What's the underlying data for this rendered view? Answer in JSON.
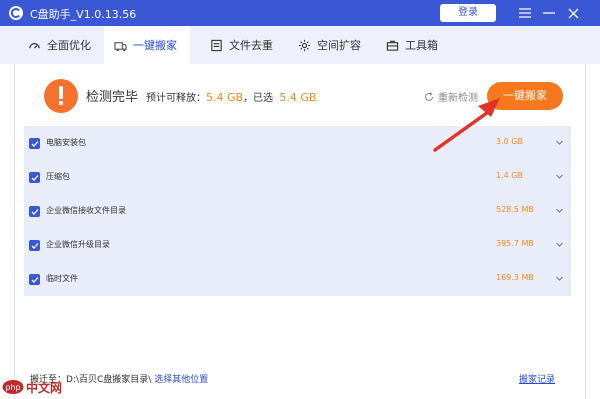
{
  "window": {
    "title": "C盘助手_V1.0.13.56",
    "login_label": "登录",
    "icons": [
      "app-logo-icon",
      "menu-icon",
      "minimize-icon",
      "close-icon"
    ]
  },
  "tabs": [
    {
      "label": "全面优化",
      "icon": "dashboard-icon",
      "active": false
    },
    {
      "label": "一键搬家",
      "icon": "move-icon",
      "active": true
    },
    {
      "label": "文件去重",
      "icon": "files-icon",
      "active": false
    },
    {
      "label": "空间扩容",
      "icon": "gear-icon",
      "active": false
    },
    {
      "label": "工具箱",
      "icon": "toolbox-icon",
      "active": false
    }
  ],
  "status": {
    "title": "检测完毕",
    "prefix": "预计可释放：",
    "releasable": "5.4 GB",
    "middle": "，已选",
    "selected": "5.4 GB",
    "recheck_label": "重新检测",
    "action_label": "一键搬家"
  },
  "items": [
    {
      "name": "电脑安装包",
      "size": "3.0 GB",
      "checked": true
    },
    {
      "name": "压缩包",
      "size": "1.4 GB",
      "checked": true
    },
    {
      "name": "企业微信接收文件目录",
      "size": "528.5 MB",
      "checked": true
    },
    {
      "name": "企业微信升级目录",
      "size": "395.7 MB",
      "checked": true
    },
    {
      "name": "临时文件",
      "size": "169.3 MB",
      "checked": true
    }
  ],
  "footer": {
    "label": "搬迁至：",
    "path": "D:\\百贝C盘搬家目录\\",
    "choose_label": "选择其他位置",
    "history_label": "搬家记录"
  },
  "watermark": {
    "text": "php 中文网"
  },
  "colors": {
    "brand_blue": "#3a57d6",
    "accent_orange": "#f7781c",
    "list_bg": "#e9edfa"
  }
}
